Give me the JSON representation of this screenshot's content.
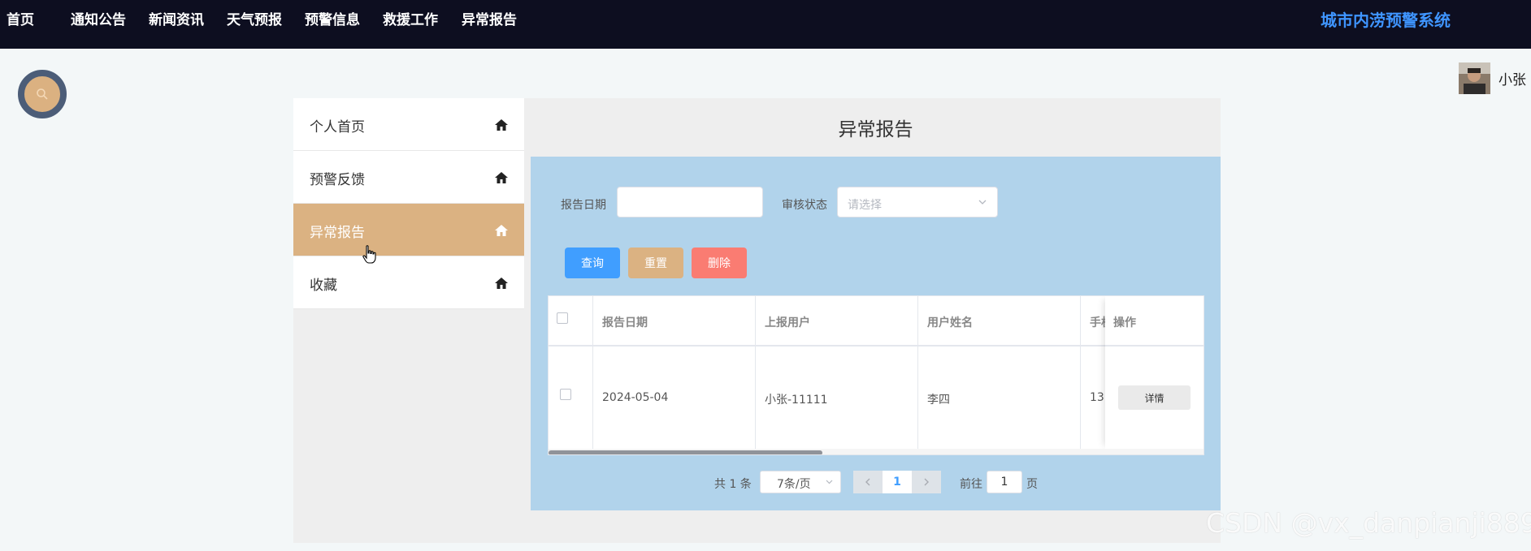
{
  "nav": {
    "items": [
      "首页",
      "通知公告",
      "新闻资讯",
      "天气预报",
      "预警信息",
      "救援工作",
      "异常报告"
    ],
    "site_title": "城市内涝预警系统"
  },
  "user": {
    "name": "小张"
  },
  "sidebar": {
    "items": [
      {
        "label": "个人首页",
        "active": false
      },
      {
        "label": "预警反馈",
        "active": false
      },
      {
        "label": "异常报告",
        "active": true
      },
      {
        "label": "收藏",
        "active": false
      }
    ]
  },
  "page": {
    "title": "异常报告"
  },
  "filters": {
    "date_label": "报告日期",
    "date_value": "",
    "status_label": "审核状态",
    "status_placeholder": "请选择"
  },
  "buttons": {
    "query": "查询",
    "reset": "重置",
    "delete": "删除"
  },
  "table": {
    "headers": [
      "报告日期",
      "上报用户",
      "用户姓名",
      "手机",
      "操作"
    ],
    "rows": [
      {
        "date": "2024-05-04",
        "reporter": "小张-11111",
        "name": "李四",
        "phone": "13",
        "action": "详情"
      }
    ]
  },
  "pagination": {
    "total_text": "共 1 条",
    "page_size": "7条/页",
    "current_page": "1",
    "goto_label": "前往",
    "goto_value": "1",
    "page_suffix": "页"
  },
  "watermark": "CSDN @vx_danpianji889",
  "colors": {
    "nav_bg": "#0d0e20",
    "site_title": "#3f95ff",
    "sidebar_active": "#dbb282",
    "main_box": "#b1d3eb",
    "query_button": "#409eff",
    "reset_button": "#dbb282",
    "delete_button": "#fa7c72"
  }
}
